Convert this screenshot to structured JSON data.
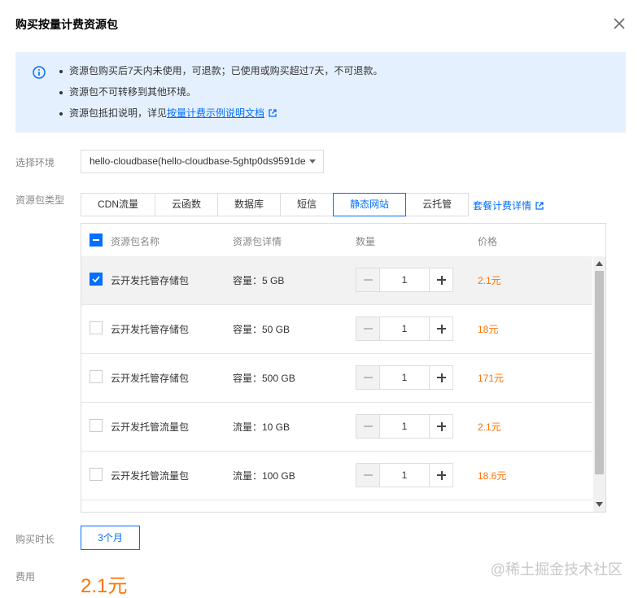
{
  "dialog": {
    "title": "购买按量计费资源包",
    "close_icon": "close-icon"
  },
  "notice": {
    "icon": "info-icon",
    "items": [
      "资源包购买后7天内未使用，可退款；已使用或购买超过7天，不可退款。",
      "资源包不可转移到其他环境。"
    ],
    "third_prefix": "资源包抵扣说明，详见",
    "third_link": "按量计费示例说明文档"
  },
  "form": {
    "env_label": "选择环境",
    "env_value": "hello-cloudbase(hello-cloudbase-5ghtp0ds9591de",
    "type_label": "资源包类型",
    "duration_label": "购买时长",
    "fee_label": "费用"
  },
  "tabs": [
    "CDN流量",
    "云函数",
    "数据库",
    "短信",
    "静态网站",
    "云托管"
  ],
  "active_tab": "静态网站",
  "plan_link": "套餐计费详情",
  "table": {
    "headers": {
      "name": "资源包名称",
      "detail": "资源包详情",
      "qty": "数量",
      "price": "价格"
    },
    "rows": [
      {
        "name": "云开发托管存储包",
        "detail": "容量：5 GB",
        "qty": "1",
        "price": "2.1元",
        "checked": true
      },
      {
        "name": "云开发托管存储包",
        "detail": "容量：50 GB",
        "qty": "1",
        "price": "18元",
        "checked": false
      },
      {
        "name": "云开发托管存储包",
        "detail": "容量：500 GB",
        "qty": "1",
        "price": "171元",
        "checked": false
      },
      {
        "name": "云开发托管流量包",
        "detail": "流量：10 GB",
        "qty": "1",
        "price": "2.1元",
        "checked": false
      },
      {
        "name": "云开发托管流量包",
        "detail": "流量：100 GB",
        "qty": "1",
        "price": "18.6元",
        "checked": false
      },
      {
        "name": "",
        "detail": "",
        "qty": "",
        "price": "",
        "checked": false
      }
    ]
  },
  "duration": "3个月",
  "fee": "2.1元",
  "watermark": "@稀土掘金技术社区",
  "colors": {
    "accent": "#006eff",
    "price": "#ff7200",
    "notice_bg": "#e5f0ff"
  }
}
